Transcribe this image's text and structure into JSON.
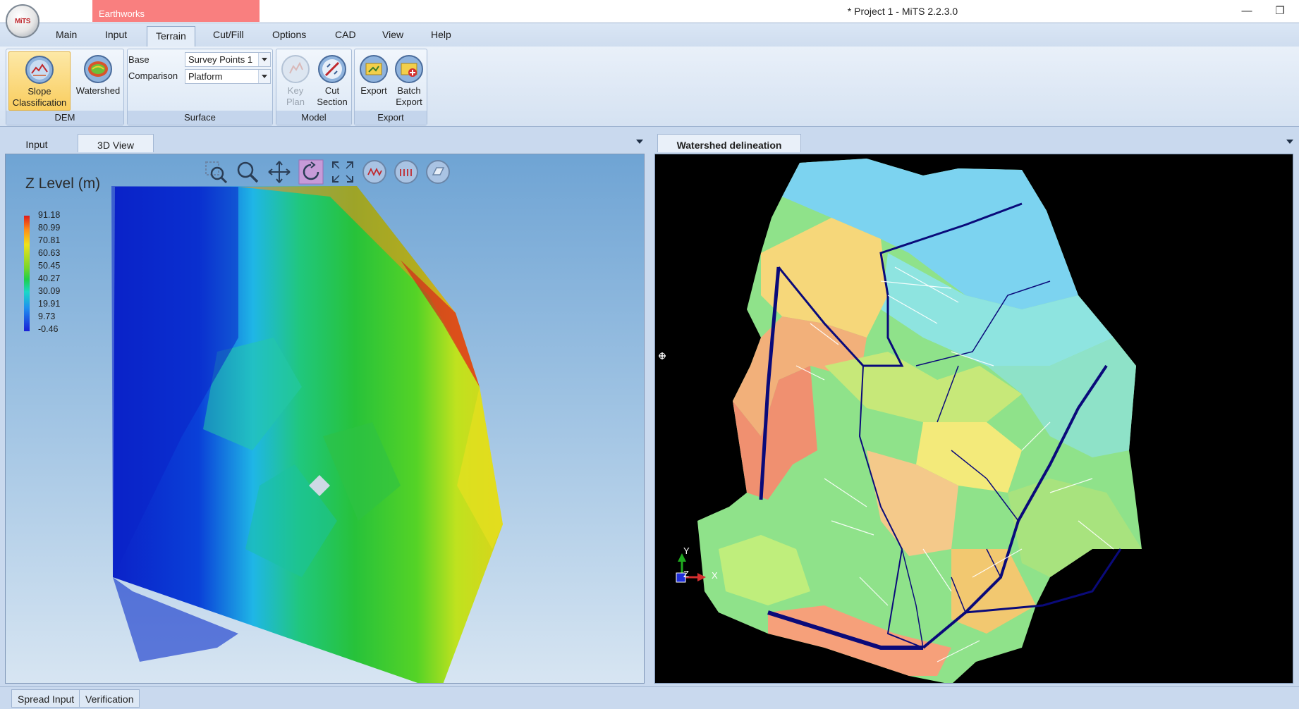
{
  "window": {
    "title": "* Project 1 - MiTS 2.2.3.0",
    "context_tab": "Earthworks",
    "logo_text": "MiTS",
    "minimize_glyph": "—",
    "restore_glyph": "❐"
  },
  "menu": {
    "tabs": [
      "Main",
      "Input",
      "Terrain",
      "Cut/Fill",
      "Options",
      "CAD",
      "View",
      "Help"
    ],
    "active": "Terrain"
  },
  "ribbon": {
    "dem": {
      "label": "DEM",
      "slope_line1": "Slope",
      "slope_line2": "Classification",
      "watershed": "Watershed"
    },
    "surface": {
      "label": "Surface",
      "base_label": "Base",
      "base_value": "Survey Points 1",
      "comparison_label": "Comparison",
      "comparison_value": "Platform"
    },
    "model": {
      "label": "Model",
      "keyplan_line1": "Key",
      "keyplan_line2": "Plan",
      "cut_line1": "Cut",
      "cut_line2": "Section"
    },
    "export": {
      "label": "Export",
      "export": "Export",
      "batch_line1": "Batch",
      "batch_line2": "Export"
    }
  },
  "left_pane": {
    "tabs": [
      "Input",
      "3D View"
    ],
    "active": "3D View",
    "legend": {
      "title": "Z Level (m)",
      "ticks": [
        "91.18",
        "80.99",
        "70.81",
        "60.63",
        "50.45",
        "40.27",
        "30.09",
        "19.91",
        "9.73",
        "-0.46"
      ]
    },
    "tool_icons": [
      "zoom-window-icon",
      "zoom-icon",
      "pan-icon",
      "rotate-icon",
      "fit-extents-icon",
      "cut-profile-icon",
      "fill-profile-icon",
      "transparency-icon"
    ]
  },
  "right_pane": {
    "tabs": [
      "Watershed delineation"
    ],
    "axis": {
      "y": "Y",
      "x": "X",
      "z": "Z"
    }
  },
  "statusbar": {
    "tabs": [
      "Spread Input",
      "Verification"
    ]
  },
  "colors": {
    "accent_tab": "#f97f7f",
    "ribbon_selected": "#f9cd5e",
    "watershed_channel": "#0a0a7a"
  }
}
